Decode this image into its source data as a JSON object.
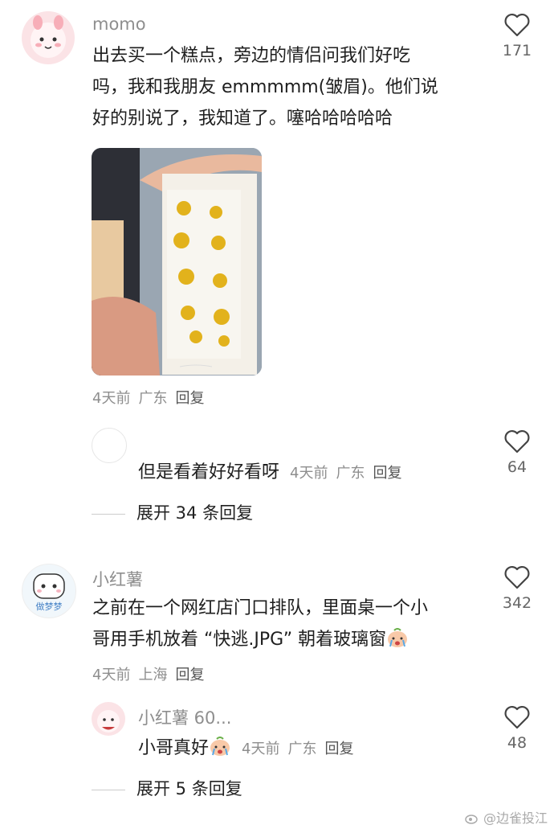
{
  "comments": [
    {
      "username": "momo",
      "text_lines": [
        "出去买一个糕点，旁边的情侣问我们好吃",
        "吗，我和我朋友 emmmmm(皱眉)。他们说",
        "好的别说了，我知道了。噻哈哈哈哈哈"
      ],
      "time": "4天前",
      "location": "广东",
      "reply_label": "回复",
      "likes": "171"
    },
    {
      "username": "",
      "text": "但是看着好好看呀",
      "time": "4天前",
      "location": "广东",
      "reply_label": "回复",
      "likes": "64"
    },
    {
      "username": "小红薯",
      "avatar_text": "做梦梦",
      "text_lines": [
        "之前在一个网红店门口排队，里面桌一个小",
        "哥用手机放着 “快逃.JPG” 朝着玻璃窗"
      ],
      "time": "4天前",
      "location": "上海",
      "reply_label": "回复",
      "likes": "342"
    },
    {
      "username": "小红薯 60...",
      "text": "小哥真好",
      "time": "4天前",
      "location": "广东",
      "reply_label": "回复",
      "likes": "48"
    }
  ],
  "expand": [
    {
      "label": "展开 34 条回复"
    },
    {
      "label": "展开 5 条回复"
    }
  ],
  "watermark": "@边雀投江",
  "colors": {
    "meta": "#8e8e8e",
    "text": "#1e1e1e",
    "cake_gold": "#e2b21c"
  }
}
